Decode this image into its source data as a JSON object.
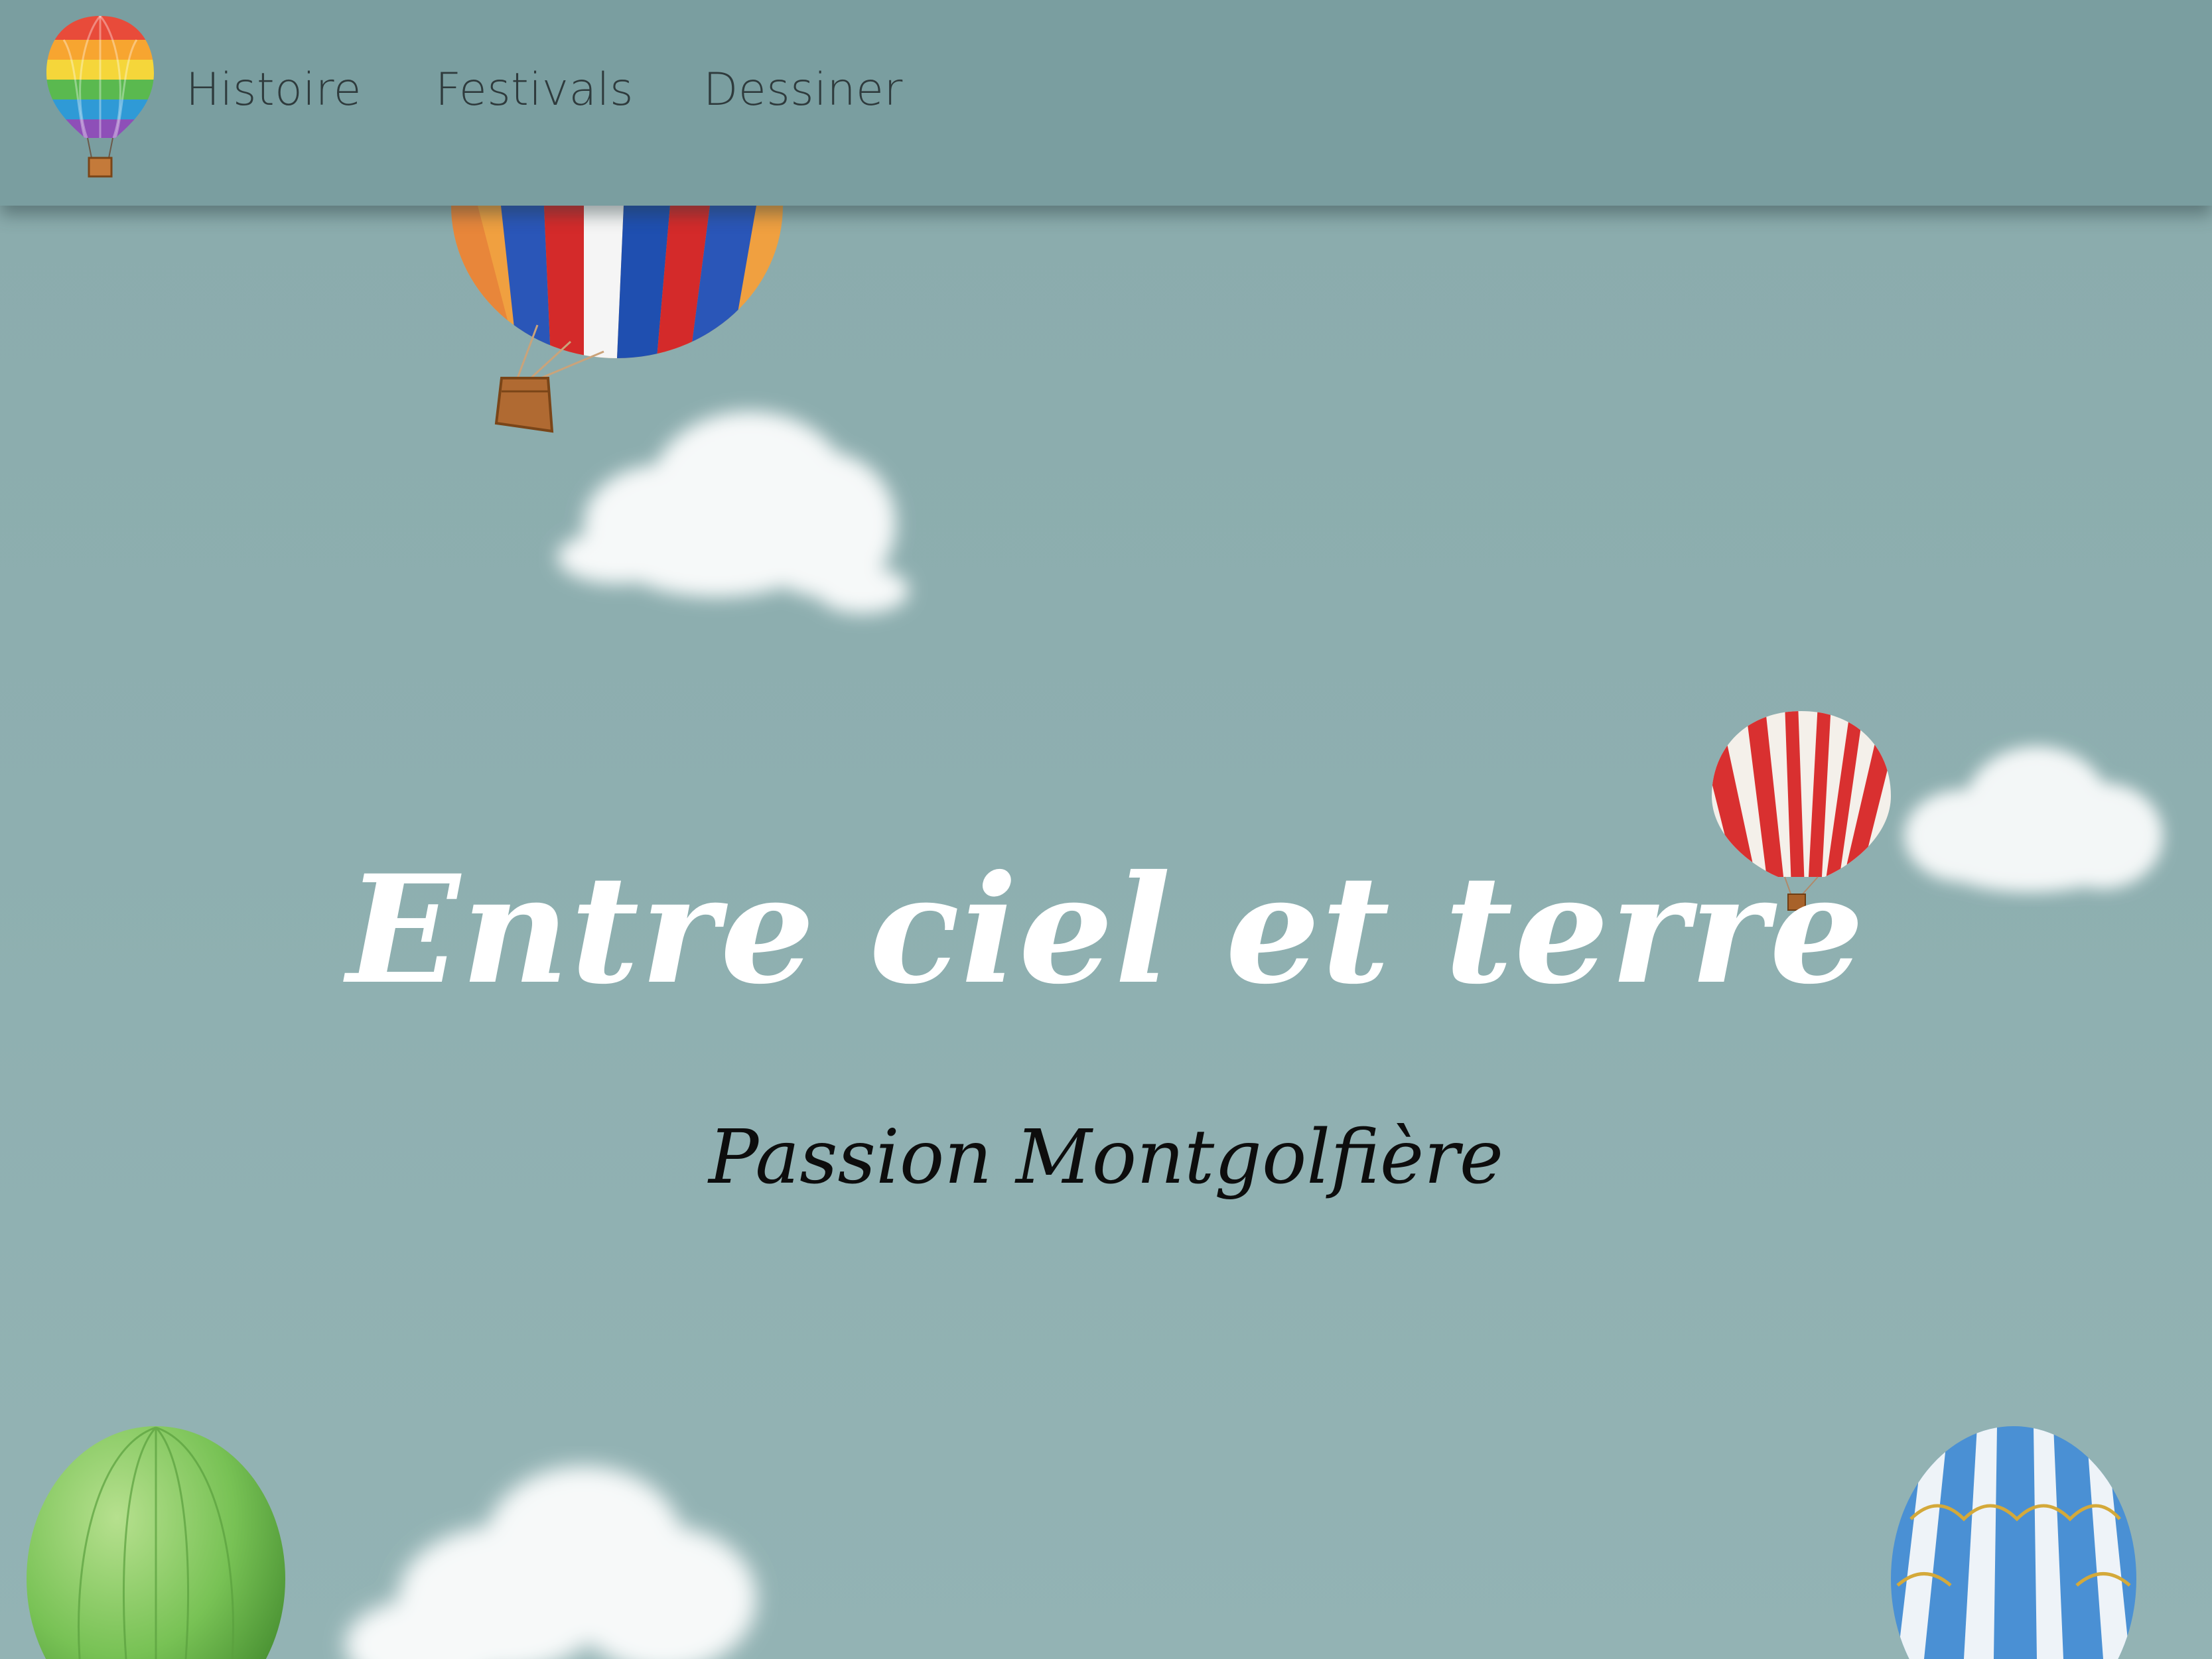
{
  "nav": {
    "logo_icon": "hot-air-balloon-logo-icon",
    "links": [
      {
        "label": "Histoire"
      },
      {
        "label": "Festivals"
      },
      {
        "label": "Dessiner"
      }
    ]
  },
  "hero": {
    "title": "Entre ciel et terre",
    "subtitle": "Passion Montgolfière"
  },
  "decorations": {
    "balloons": [
      "multicolor-balloon-icon",
      "red-striped-balloon-icon",
      "green-balloon-icon",
      "blue-striped-balloon-icon"
    ],
    "clouds": [
      "cloud-icon"
    ]
  },
  "colors": {
    "navbar": "#7a9ea0",
    "sky": "#8dafb0",
    "title": "#ffffff",
    "subtitle": "#0d0d0d"
  }
}
